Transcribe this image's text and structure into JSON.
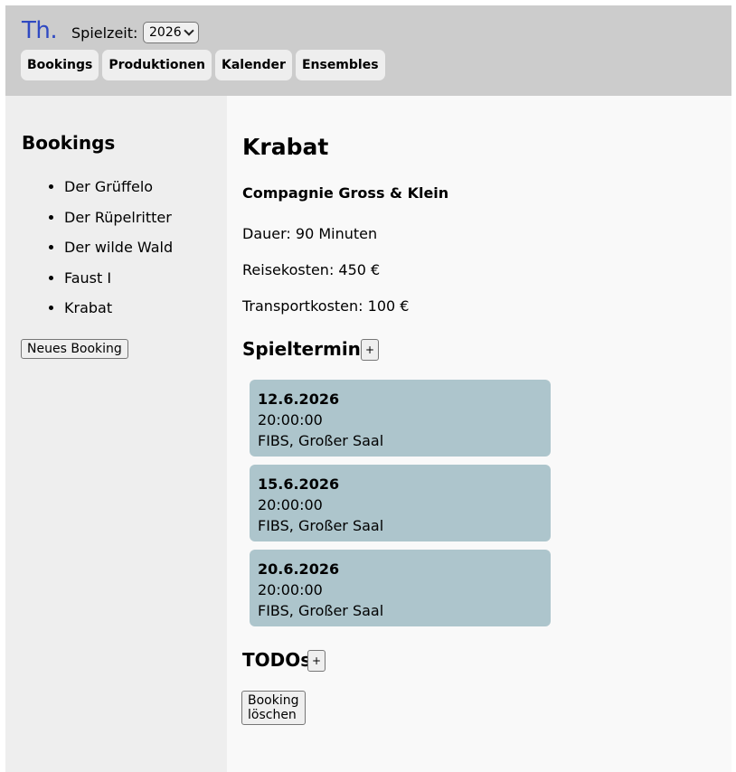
{
  "header": {
    "logo": "Th.",
    "season_label": "Spielzeit:",
    "season_value": "2026",
    "nav": [
      "Bookings",
      "Produktionen",
      "Kalender",
      "Ensembles"
    ]
  },
  "sidebar": {
    "title": "Bookings",
    "items": [
      "Der Grüffelo",
      "Der Rüpelritter",
      "Der wilde Wald",
      "Faust I",
      "Krabat"
    ],
    "new_button": "Neues Booking"
  },
  "main": {
    "title": "Krabat",
    "company": "Compagnie Gross & Klein",
    "duration": "Dauer: 90 Minuten",
    "travel_cost": "Reisekosten: 450 €",
    "transport_cost": "Transportkosten: 100 €",
    "dates_heading": "Spieltermine",
    "add_label": "+",
    "dates": [
      {
        "date": "12.6.2026",
        "time": "20:00:00",
        "venue": "FIBS, Großer Saal"
      },
      {
        "date": "15.6.2026",
        "time": "20:00:00",
        "venue": "FIBS, Großer Saal"
      },
      {
        "date": "20.6.2026",
        "time": "20:00:00",
        "venue": "FIBS, Großer Saal"
      }
    ],
    "todos_heading": "TODOs",
    "delete_button": "Booking löschen"
  },
  "colors": {
    "header_bg": "#cccccc",
    "sidebar_bg": "#eeeeee",
    "card_bg": "#adc5cc",
    "logo": "#2f49c2"
  }
}
